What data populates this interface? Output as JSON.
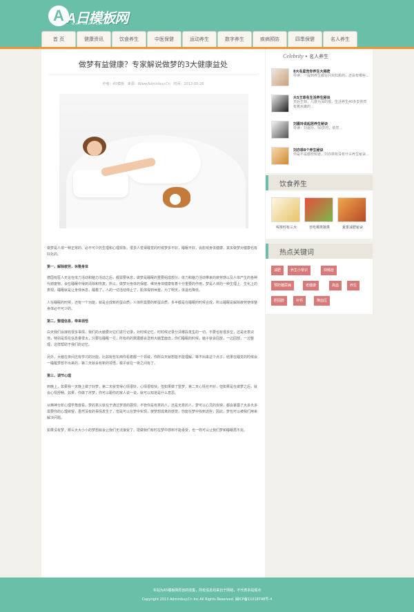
{
  "brand": {
    "logo_letter": "A",
    "logo_text": "A日模板网",
    "logo_url": "www.adminbuy.cn"
  },
  "nav": [
    "首 页",
    "健康资讯",
    "饮食养生",
    "中医保健",
    "运动养生",
    "数字养生",
    "疾病预防",
    "四季保健",
    "名人养生"
  ],
  "article": {
    "title": "做梦有益健康？专家解说做梦的3大健康益处",
    "meta": "作者：A5模板 来源：Www.Adminbuy.Cn 时间：2013-05-26",
    "paragraphs": [
      {
        "type": "p",
        "text": "做梦是人体一种正常的、必不可少的生理和心理现象。很多人觉得睡觉的时候梦多不好，睡眠不好，会影响身体健康，其实做梦对健康也有好处的。"
      },
      {
        "type": "h",
        "text": "第一，解除疲劳，休整身体"
      },
      {
        "type": "p",
        "text": "德国有医人无论在体力活动和脑力活动之后，都需要休息，做梦是睡眠的重要组成部分。体力和脑力活动带来的疲劳感以及人体产生的各种代谢废物，会在睡眠中得到清除和恢复。所以，做梦对身体的保健、维持身体健康有着十分重要的作用，梦是人体的一种生理上、生化上的表现。睡眠就是让身体休息，睡着了，人的一切活动停止了，肌体得到休整，为了明天，体温也降低。"
      },
      {
        "type": "p",
        "text": "人在睡眠的时候，还有一个功能，就是合成新的蛋白质。人体所需要的新蛋白质，多半都是在睡眠的时候合成，所以睡眠是解除疲劳使体整身体必不可少的。"
      },
      {
        "type": "h",
        "text": "第二，整理信息，带来领悟"
      },
      {
        "type": "p",
        "text": "白天我们会接收很多事情，我们的大脑要对它们进行记录，对时候记忆，时时候记录分清哪段发生的一切。不要也有很多空，还是无意识地，特别是现在信息量很大，只要在睡眠一行，所有的的数据都会送到大脑里面去，你们睡眠的时候，脑子就会回放，一边回放，一边整理，这样帮助于我们的记忆。"
      },
      {
        "type": "p",
        "text": "另外，大脑在夜间还有学习的功能。比如有些东西你看着都一个领域，你所白天就想能不能理解，等不出来这个点子，结果在睡觉的时候会一睡醒梦想不出来的，第二天就会有新的领悟，稿子就在一夜之间有了。"
      },
      {
        "type": "h",
        "text": "第三，调节心理"
      },
      {
        "type": "p",
        "text": "到晚上，如果我一天晚上做了好梦，第二天就觉得心情很好，心情很愉快。但如果做了噩梦，第二天心情也不好，但如果是在做梦之后，就会心情舒畅。如果，你做了坏梦，你可以跟你的家人说一说，就可以知道是什么意思。"
      },
      {
        "type": "p",
        "text": "从精神分析心理学角度看，梦的意义就在于通过梦境的展现，不管你是有意的人，还是无意的人，梦可以心灵的反映，都会暴露了大多大多需要你的心理欲望，虽然没有的事情发生了，但是可以在梦中实现，使梦想成真的感觉，你能在梦中找到这些，因此，梦也可以被我们用来解决问题。"
      },
      {
        "type": "p",
        "text": "如果没有梦，那么大大小小的梦想就会让我们无法接受了。把做我们有时在梦中感到不能承受，也一样可以让我们梦和睡眠再不完。"
      }
    ]
  },
  "sidebar": {
    "celebrity_heading": "Celebrity",
    "celebrity_sub": "• 名人养生",
    "celebs": [
      {
        "name": "8大名星告你养生大揭密",
        "desc": "导读：一提到养生都在问大红颜的，还会有哪些..."
      },
      {
        "name": "大S王菲名生活养生秘诀",
        "desc": "天后王菲，几度为深的婚，生活养生40多岁依然有着水嫩的..."
      },
      {
        "name": "刘嘉玲说起居养生秘诀",
        "desc": "导读：刘嘉玲、50岁时，依然..."
      },
      {
        "name": "刘亦菲8个养生秘诀",
        "desc": "你是不是都想知道，刘亦菲有没有什么养生秘诀..."
      }
    ],
    "food_heading": "饮食养生",
    "foods": [
      "喝茶时有三大",
      "日吃哪类蔬果",
      "夏季减肥秘诀"
    ],
    "tags_heading": "热点关键词",
    "tags": [
      "减肥",
      "养生小常识",
      "抑郁症",
      "预防糖尿病",
      "老健康",
      "高血",
      "养生",
      "胆固醇",
      "补钙",
      "降血压"
    ]
  },
  "footer": {
    "line1": "本站为A5模板网原创的收集，所有信息均来自于网络，不代表本站观点",
    "line2": "Copyright 2013 Adminbuy.Cn Inc.All Rights Reserved.   闽ICP备11018748号-4"
  },
  "colors": {
    "teal": "#69bfa8",
    "orange": "#f3922f",
    "tag_red": "#d87878"
  }
}
